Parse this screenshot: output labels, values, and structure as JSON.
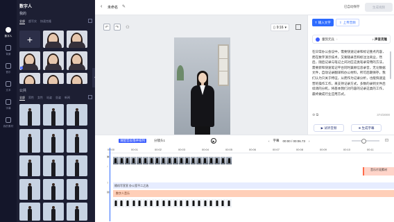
{
  "rail": {
    "items": [
      {
        "label": "数字人",
        "icon": "person-icon"
      },
      {
        "label": "背景",
        "icon": "background-icon"
      },
      {
        "label": "音乐",
        "icon": "music-icon"
      },
      {
        "label": "文本",
        "icon": "text-icon"
      },
      {
        "label": "字幕",
        "icon": "caption-icon"
      },
      {
        "label": "我的素材",
        "icon": "folder-icon"
      }
    ]
  },
  "library": {
    "title": "数字人",
    "mine": "我的",
    "mine_tabs": [
      "全部",
      "超写实",
      "快速克隆"
    ],
    "public": "公共",
    "public_tabs": [
      "全部",
      "男性",
      "女性",
      "站姿",
      "坐姿",
      "新闻"
    ]
  },
  "topbar": {
    "back": "‹",
    "title": "未命名",
    "autosave": "已自动保存",
    "generate": "生成视频"
  },
  "canvas": {
    "ratio": "9:16",
    "undo": "↶",
    "redo": "↷"
  },
  "text_panel": {
    "tab_input": "输入文字",
    "tab_upload": "上传音频",
    "voice_name": "童凯元兵",
    "voice_clone": "声音克隆",
    "script": "在日常办公会议中，需要快速记录和标记重点内容，而在数字演示技术，又要随录音和标注注商业，然后，随后记录与笔记之间对应这类笔录常用的方法，需要新和快速笔记平台同时兼顾信息录音，无论数据文件，自动记录翻译和办公材料，所可后期保存，我们认为只关于特征，从而作为记录分析，也能快速运营的操作工作，来支持记录方式，多数的录到文件后续调的分机，将基本我们对内容的记录这类的工作，最终做成行业应用方式。",
    "count": "374/3000",
    "try_listen": "试听音频",
    "generate_captions": "生成字幕"
  },
  "timeline": {
    "intro_tag": "请配音段落并排列",
    "split": "分镜头1",
    "caption": "字幕",
    "time": "00:00 / 00:06.73",
    "ruler": [
      "00:01",
      "00:02",
      "00:03",
      "00:04",
      "00:05",
      "00:06",
      "00:07",
      "00:08",
      "00:09",
      "00:10",
      "00:11",
      "00:12"
    ],
    "text_track": "随机写宣宣 办公室不二之选",
    "digital_track": "数字人音乐",
    "audio_track": "音乐片段素材"
  }
}
